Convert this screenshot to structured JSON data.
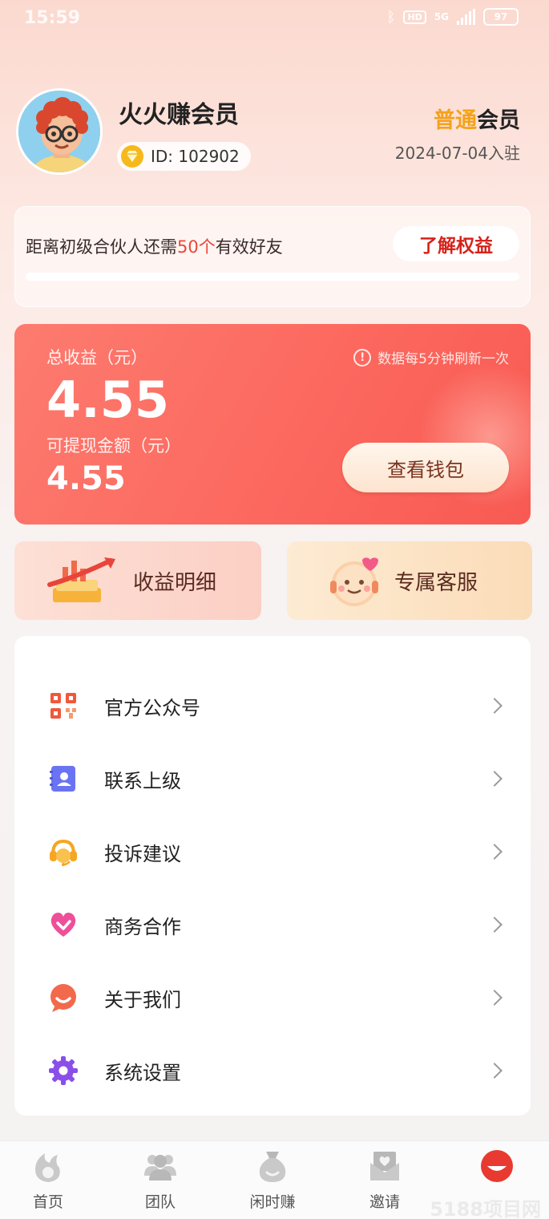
{
  "status_bar": {
    "time": "15:59",
    "hd": "HD",
    "network": "5G",
    "battery": "97"
  },
  "profile": {
    "username": "火火赚会员",
    "id_text": "ID: 102902",
    "member_level_highlight": "普通",
    "member_level_suffix": "会员",
    "join_date": "2024-07-04入驻"
  },
  "progress": {
    "text_prefix": "距离初级合伙人还需",
    "count": "50个",
    "text_suffix": "有效好友",
    "rights_button": "了解权益",
    "progress_fraction": 0
  },
  "earnings": {
    "total_label": "总收益（元）",
    "total_value": "4.55",
    "available_label": "可提现金额（元）",
    "available_value": "4.55",
    "refresh_note": "数据每5分钟刷新一次",
    "wallet_button": "查看钱包"
  },
  "quick_actions": {
    "detail_label": "收益明细",
    "service_label": "专属客服"
  },
  "menu": {
    "items": [
      {
        "label": "官方公众号",
        "icon": "qr-code-icon"
      },
      {
        "label": "联系上级",
        "icon": "contact-card-icon"
      },
      {
        "label": "投诉建议",
        "icon": "headset-icon"
      },
      {
        "label": "商务合作",
        "icon": "heart-handshake-icon"
      },
      {
        "label": "关于我们",
        "icon": "chat-bubble-icon"
      },
      {
        "label": "系统设置",
        "icon": "gear-icon"
      }
    ]
  },
  "bottom_nav": {
    "items": [
      {
        "label": "首页",
        "icon": "flame-icon"
      },
      {
        "label": "团队",
        "icon": "team-icon"
      },
      {
        "label": "闲时赚",
        "icon": "money-bag-icon"
      },
      {
        "label": "邀请",
        "icon": "invite-envelope-icon"
      },
      {
        "label": "",
        "icon": "profile-icon",
        "active": true
      }
    ],
    "watermark": "5188项目网"
  },
  "colors": {
    "accent_red": "#fc6a60",
    "member_gold": "#f4a21a",
    "progress_number": "#e8473b"
  }
}
